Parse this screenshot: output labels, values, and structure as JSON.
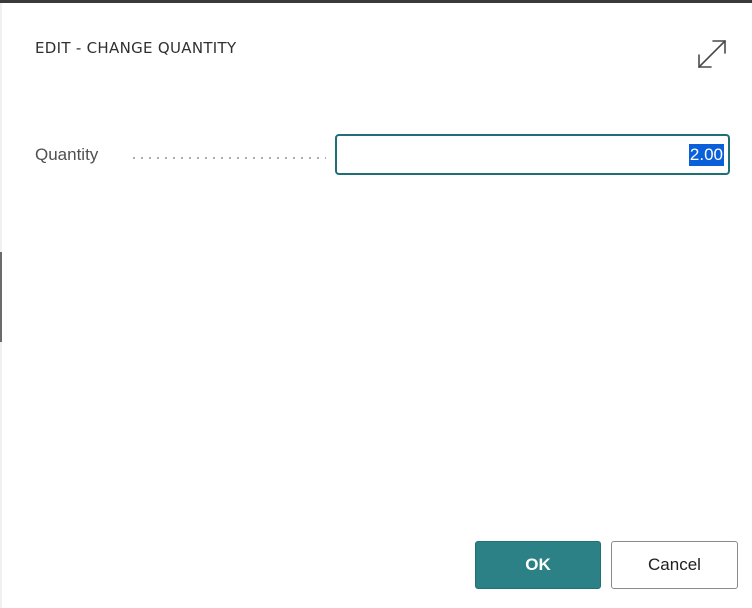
{
  "dialog": {
    "title": "EDIT - CHANGE QUANTITY",
    "expand_icon": "expand-diagonal-icon"
  },
  "form": {
    "quantity_label": "Quantity",
    "quantity_value": "2.00",
    "quantity_selected": true
  },
  "actions": {
    "ok_label": "OK",
    "cancel_label": "Cancel"
  },
  "colors": {
    "accent": "#2b8186",
    "input_border": "#1f6f74",
    "selection": "#0a60d8"
  }
}
